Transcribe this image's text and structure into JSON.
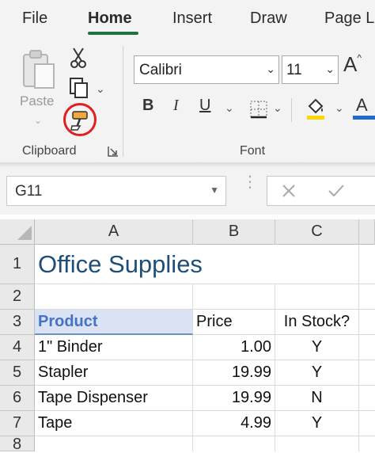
{
  "ribbon": {
    "tabs": [
      {
        "label": "File"
      },
      {
        "label": "Home",
        "active": true
      },
      {
        "label": "Insert"
      },
      {
        "label": "Draw"
      },
      {
        "label": "Page La"
      }
    ],
    "clipboard": {
      "group_label": "Clipboard",
      "paste_label": "Paste",
      "icons": [
        "clipboard-paste-icon",
        "scissors-icon",
        "copy-icon",
        "format-painter-icon",
        "dialog-launcher-icon"
      ],
      "format_painter_highlight": "#e02020"
    },
    "font": {
      "group_label": "Font",
      "font_name": "Calibri",
      "font_size": "11",
      "grow_label": "A",
      "bold_label": "B",
      "italic_label": "I",
      "underline_label": "U",
      "font_color_label": "A",
      "icons": [
        "grow-font-icon",
        "border-icon",
        "fill-color-icon",
        "font-color-icon"
      ],
      "fill_color": "#ffd700",
      "font_color": "#1f6bd0"
    }
  },
  "formula_bar": {
    "name_box": "G11",
    "formula_text": "",
    "icons": [
      "cancel-icon",
      "enter-icon"
    ]
  },
  "sheet": {
    "column_headers": [
      "A",
      "B",
      "C"
    ],
    "row_headers": [
      "1",
      "2",
      "3",
      "4",
      "5",
      "6",
      "7",
      "8"
    ],
    "title": "Office Supplies",
    "header_row": [
      "Product",
      "Price",
      "In Stock?"
    ],
    "rows": [
      [
        "1\" Binder",
        "1.00",
        "Y"
      ],
      [
        "Stapler",
        "19.99",
        "Y"
      ],
      [
        "Tape Dispenser",
        "19.99",
        "N"
      ],
      [
        "Tape",
        "4.99",
        "Y"
      ]
    ],
    "header_fill": "#dae3f3",
    "header_text_color": "#4472c4",
    "title_color": "#1f4e79"
  }
}
